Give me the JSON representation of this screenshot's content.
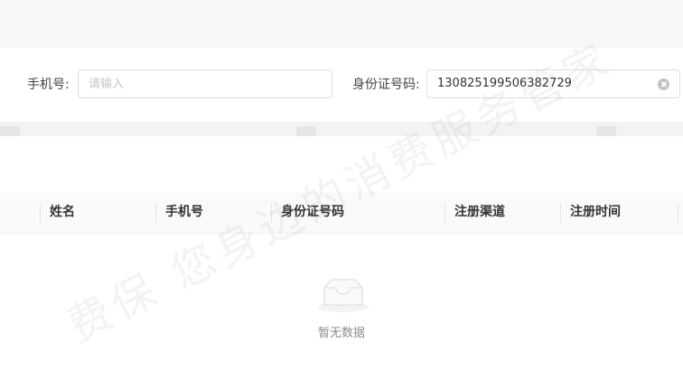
{
  "filters": {
    "phone": {
      "label": "手机号:",
      "placeholder": "请输入",
      "value": ""
    },
    "id_number": {
      "label": "身份证号码:",
      "value": "130825199506382729"
    }
  },
  "table": {
    "columns": [
      "姓名",
      "手机号",
      "身份证号码",
      "注册渠道",
      "注册时间"
    ],
    "rows": [],
    "empty_text": "暂无数据"
  },
  "watermark": "费保 您身边的消费服务管家",
  "icons": {
    "clear": "clear-circle-icon",
    "empty": "empty-inbox-icon"
  },
  "colors": {
    "header_bg": "#fafafa",
    "band_bg": "#f7f7f8",
    "border": "#dcdfe6",
    "placeholder": "#c0c4cc"
  }
}
